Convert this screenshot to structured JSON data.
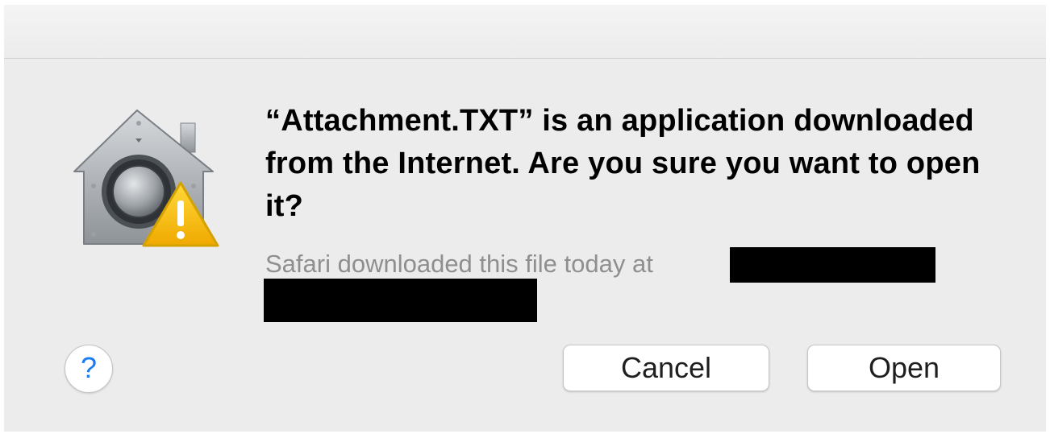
{
  "dialog": {
    "icon": "gatekeeper-warning-icon",
    "headline": "“Attachment.TXT” is an application downloaded from the Internet. Are you sure you want to open it?",
    "info": "Safari downloaded this file today at",
    "help_icon": "question-icon",
    "help_glyph": "?",
    "buttons": {
      "cancel_label": "Cancel",
      "open_label": "Open"
    }
  },
  "colors": {
    "background": "#ececec",
    "help_accent": "#1a7cf5",
    "warning": "#f5b800",
    "secondary_text": "#8f8f8f"
  }
}
